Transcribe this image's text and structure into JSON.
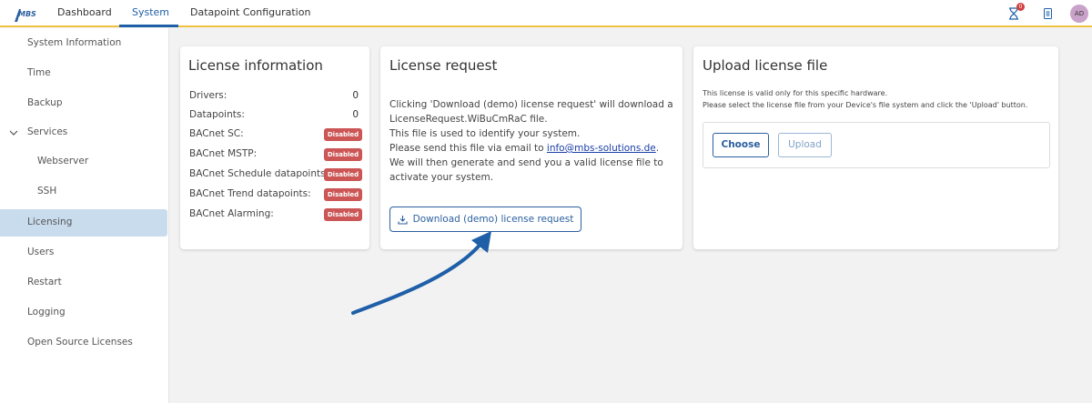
{
  "brand": {
    "logo_text": "MBS"
  },
  "nav": {
    "tabs": [
      {
        "label": "Dashboard",
        "active": false
      },
      {
        "label": "System",
        "active": true
      },
      {
        "label": "Datapoint Configuration",
        "active": false
      }
    ]
  },
  "header_right": {
    "notification_count": "0",
    "avatar_initials": "AD"
  },
  "sidebar": {
    "items": [
      {
        "label": "System Information"
      },
      {
        "label": "Time"
      },
      {
        "label": "Backup"
      },
      {
        "label": "Services"
      },
      {
        "label": "Webserver"
      },
      {
        "label": "SSH"
      },
      {
        "label": "Licensing"
      },
      {
        "label": "Users"
      },
      {
        "label": "Restart"
      },
      {
        "label": "Logging"
      },
      {
        "label": "Open Source Licenses"
      }
    ],
    "active_item": "Licensing"
  },
  "license_info": {
    "title": "License information",
    "rows": [
      {
        "label": "Drivers:",
        "value": "0"
      },
      {
        "label": "Datapoints:",
        "value": "0"
      },
      {
        "label": "BACnet SC:",
        "value": "Disabled"
      },
      {
        "label": "BACnet MSTP:",
        "value": "Disabled"
      },
      {
        "label": "BACnet Schedule datapoints:",
        "value": "Disabled"
      },
      {
        "label": "BACnet Trend datapoints:",
        "value": "Disabled"
      },
      {
        "label": "BACnet Alarming:",
        "value": "Disabled"
      }
    ]
  },
  "license_request": {
    "title": "License request",
    "line1": "Clicking 'Download (demo) license request' will download a",
    "line2": "LicenseRequest.WiBuCmRaC file.",
    "line3": "This file is used to identify your system.",
    "line4_prefix": "Please send this file via email to ",
    "email": "info@mbs-solutions.de",
    "line4_suffix": ".",
    "line5": "We will then generate and send you a valid license file to",
    "line6": "activate your system.",
    "button_label": "Download (demo) license request"
  },
  "upload": {
    "title": "Upload license file",
    "line1": "This license is valid only for this specific hardware.",
    "line2": "Please select the license file from your Device's file system and click the 'Upload' button.",
    "choose_label": "Choose",
    "upload_label": "Upload"
  },
  "colors": {
    "accent": "#1e5fa8",
    "header_underline": "#f0c040",
    "disabled_badge": "#cc5555",
    "active_sidebar": "#c9dcee",
    "annotation_arrow": "#1e5fa8"
  }
}
